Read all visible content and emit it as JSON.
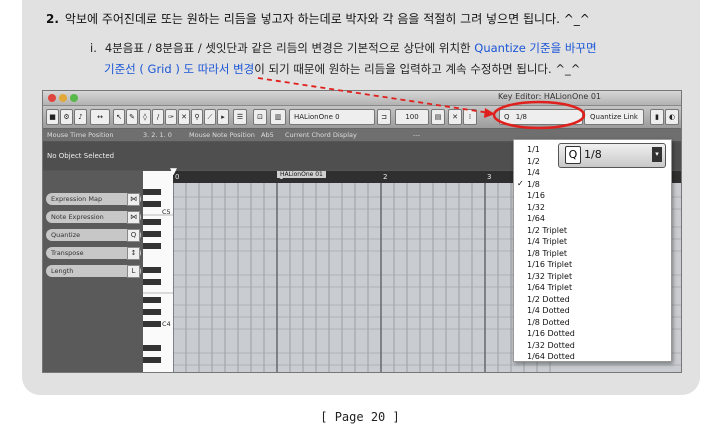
{
  "doc": {
    "step_number": "2.",
    "step_text": "악보에 주어진데로 또는 원하는 리듬을 넣고자 하는데로 박자와 각 음을 적절히 그려 넣으면 됩니다. ^_^",
    "sub_number": "i.",
    "sub_text_a": "4분음표 / 8분음표 / 셋잇단과 같은 리듬의 변경은 기본적으로 상단에 위치한 ",
    "sub_text_blue1": "Quantize 기준을 바꾸면",
    "sub_text_blue2": "기준선 ( Grid ) 도 따라서 변경",
    "sub_text_b": "이 되기 때문에 원하는 리듬을 입력하고 계속 수정하면 됩니다. ^_^",
    "page_footer": "[ Page 20 ]"
  },
  "app": {
    "window_title": "Key Editor: HALionOne 01",
    "toolbar": {
      "track_name": "HALionOne 0",
      "velocity": "100",
      "quantize_value": "1/8",
      "quantize_link": "Quantize Link"
    },
    "info": {
      "mouse_time_label": "Mouse Time Position",
      "mouse_time_value": "3. 2. 1. 0",
      "mouse_note_label": "Mouse Note Position",
      "mouse_note_value": "Ab5",
      "chord_label": "Current Chord Display",
      "chord_value": "---"
    },
    "status": "No Object Selected",
    "ruler": {
      "marks": [
        "0",
        "1",
        "2",
        "3"
      ],
      "part_name": "HALionOne 01"
    },
    "left_panel": [
      {
        "label": "Expression Map",
        "key": "⋈"
      },
      {
        "label": "Note Expression",
        "key": "⋈"
      },
      {
        "label": "Quantize",
        "key": "Q"
      },
      {
        "label": "Transpose",
        "key": "↕"
      },
      {
        "label": "Length",
        "key": "L"
      }
    ],
    "keys": {
      "c5": "C5",
      "c4": "C4"
    },
    "zoom_box_value": "1/8",
    "quantize_menu": {
      "selected": "1/8",
      "items": [
        "1/1",
        "1/2",
        "1/4",
        "1/8",
        "1/16",
        "1/32",
        "1/64",
        "1/2  Triplet",
        "1/4  Triplet",
        "1/8  Triplet",
        "1/16  Triplet",
        "1/32  Triplet",
        "1/64  Triplet",
        "1/2  Dotted",
        "1/4  Dotted",
        "1/8  Dotted",
        "1/16  Dotted",
        "1/32  Dotted",
        "1/64  Dotted"
      ]
    }
  },
  "colors": {
    "accent_blue": "#1a56d6",
    "annotation_red": "#e0201c"
  }
}
